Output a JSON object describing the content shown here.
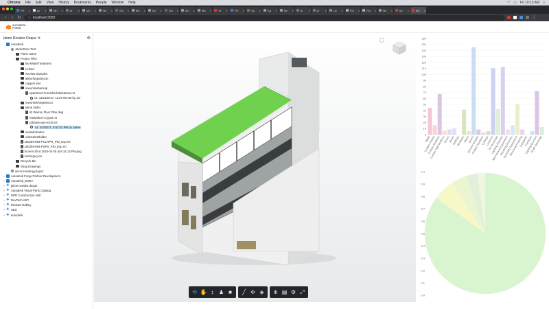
{
  "menubar": {
    "app": "Chrome",
    "items": [
      "File",
      "Edit",
      "View",
      "History",
      "Bookmarks",
      "People",
      "Window",
      "Help"
    ],
    "clock": "Fri 10:15 AM"
  },
  "browser": {
    "tabs": [
      "PR",
      "ge",
      "Mn",
      "je",
      "Mn",
      "Mn",
      "Sm",
      "Mn",
      "Mn",
      "Sm",
      "Mn",
      "Mn",
      "Yo",
      "PR",
      "Sp",
      "Aq",
      "Mn",
      "je",
      "je",
      "Lin",
      "Pro",
      "Pro",
      "Mn",
      "Mn",
      "Mn"
    ],
    "active_tab_index": 24,
    "url": "localhost:3000"
  },
  "header": {
    "logo_line1": "AUTODESK",
    "logo_line2": "FORGE",
    "logo_color": "#f0892a"
  },
  "sidebar": {
    "user": "Jaime Rosales Duque",
    "user_icon": "refresh-icon",
    "settings_icon": "gear-icon",
    "tree": [
      {
        "label": "Autodesk",
        "type": "hub",
        "level": 0,
        "toggle": "-"
      },
      {
        "label": "JaimeDocs Test",
        "type": "proj",
        "level": 1,
        "toggle": "-"
      },
      {
        "label": "Plans Jaime",
        "type": "folder",
        "level": 2,
        "toggle": ""
      },
      {
        "label": "Project Files",
        "type": "folder",
        "level": 2,
        "toggle": "-"
      },
      {
        "label": "BV-WaterTreatment",
        "type": "folder",
        "level": 3,
        "toggle": ""
      },
      {
        "label": "Linked",
        "type": "folder",
        "level": 3,
        "toggle": ""
      },
      {
        "label": "RevitIO Samples",
        "type": "folder",
        "level": 3,
        "toggle": ""
      },
      {
        "label": "aikforforgedecron",
        "type": "folder",
        "level": 3,
        "toggle": ""
      },
      {
        "label": "copperi test",
        "type": "folder",
        "level": 3,
        "toggle": ""
      },
      {
        "label": "imeonlinebackup",
        "type": "folder",
        "level": 3,
        "toggle": "-"
      },
      {
        "label": "Apartment-Furnished-Balcatons.rvt",
        "type": "file",
        "level": 4,
        "toggle": "-"
      },
      {
        "label": "v1: 11/13/2017, 11:57:06 AM by Jai",
        "type": "ver",
        "level": 5,
        "toggle": ""
      },
      {
        "label": "imeonlineforgedecon",
        "type": "folder",
        "level": 3,
        "toggle": ""
      },
      {
        "label": "jaime folder",
        "type": "folder",
        "level": 3,
        "toggle": "-"
      },
      {
        "label": "43 Warren Floor Plan.dwg",
        "type": "file",
        "level": 4,
        "toggle": ""
      },
      {
        "label": "Hackathon-Crypto.rvt",
        "type": "file",
        "level": 4,
        "toggle": ""
      },
      {
        "label": "UrbanHouse-2015.rvt",
        "type": "file",
        "level": 4,
        "toggle": "-"
      },
      {
        "label": "v1: 3/2/2017, 9:02:03 PM by Jaime",
        "type": "ver",
        "level": 5,
        "toggle": "",
        "selected": true
      },
      {
        "label": "scaledrobotics",
        "type": "folder",
        "level": 3,
        "toggle": ""
      },
      {
        "label": "visitsubnetfolder",
        "type": "folder",
        "level": 3,
        "toggle": ""
      },
      {
        "label": "180289-893-PCLRPR_PID_Exp.rvt",
        "type": "file",
        "level": 3,
        "toggle": ""
      },
      {
        "label": "180289-892-PSPS_PID_Exp.rvt",
        "type": "file",
        "level": 3,
        "toggle": ""
      },
      {
        "label": "Screen Shot 2018-02-25 at 8.14.13 PM.png",
        "type": "file",
        "level": 3,
        "toggle": ""
      },
      {
        "label": "zoeforge.json",
        "type": "file",
        "level": 3,
        "toggle": ""
      },
      {
        "label": "Recycle Bin",
        "type": "folder",
        "level": 2,
        "toggle": ""
      },
      {
        "label": "Shop Drawings",
        "type": "folder",
        "level": 2,
        "toggle": ""
      },
      {
        "label": "aecom-testing-project",
        "type": "proj",
        "level": 1,
        "toggle": ""
      },
      {
        "label": "Autodesk Forge Partner Development",
        "type": "hub",
        "level": 0,
        "toggle": "+"
      },
      {
        "label": "Autodesk_EMEA",
        "type": "hub",
        "level": 0,
        "toggle": "+"
      },
      {
        "label": "jaime.rosales.duque",
        "type": "plus",
        "level": 0,
        "toggle": "+"
      },
      {
        "label": "Autodesk Visual Parts Catalog",
        "type": "plus",
        "level": 0,
        "toggle": "+"
      },
      {
        "label": "DPR Construction Hub",
        "type": "plus",
        "level": 0,
        "toggle": "+"
      },
      {
        "label": "DevTech AEC",
        "type": "plus",
        "level": 0,
        "toggle": "+"
      },
      {
        "label": "Michael Oakley",
        "type": "plus",
        "level": 0,
        "toggle": "+"
      },
      {
        "label": "SES",
        "type": "plus",
        "level": 0,
        "toggle": "+"
      },
      {
        "label": "autodesk",
        "type": "plus",
        "level": 0,
        "toggle": "+"
      }
    ]
  },
  "viewer": {
    "toolbar": [
      [
        "orbit-icon",
        "pan-icon",
        "zoom-icon",
        "first-person-icon",
        "camera-icon"
      ],
      [
        "measure-icon",
        "explode-icon",
        "section-icon"
      ],
      [
        "model-browser-icon",
        "properties-icon",
        "settings-icon",
        "fullscreen-icon"
      ]
    ],
    "active_tool": "orbit-icon"
  },
  "chart_data": [
    {
      "type": "bar",
      "ylim": [
        0,
        160
      ],
      "yticks": [
        0,
        10,
        20,
        30,
        40,
        50,
        60,
        70,
        80,
        90,
        100,
        110,
        120,
        130,
        140,
        150,
        160
      ],
      "categories": [
        "Walls",
        "Curtain Panels",
        "Curtain Systems",
        "Curtain Wall Mullions",
        "Floors",
        "Roofs",
        "Railings",
        "Windows",
        "Stairs",
        "Doors",
        "Generic Models",
        "Curtain Systems",
        "Ceilings",
        "Columns",
        "Air Terminals",
        "Lighting Fixtures",
        "Mechanical Equipment",
        "Plumbing Fixtures",
        "Specialty Equipment",
        "Structural Framing",
        "Casework",
        "Furniture",
        "Lighting Devices",
        "Shaft Openings"
      ],
      "values": [
        44,
        15,
        67,
        6,
        8,
        10,
        0,
        41,
        5,
        145,
        8,
        3,
        5,
        110,
        42,
        112,
        8,
        15,
        50,
        8,
        0,
        5,
        72,
        12
      ],
      "colors": [
        "#f2c9d2",
        "#f9d3dc",
        "#d9c6df",
        "#fbdad4",
        "#e7d9ee",
        "#d8e3f6",
        "#dcdcdc",
        "#d7e6bf",
        "#f7e0c0",
        "#c8def2",
        "#d7cbe7",
        "#f1d6e0",
        "#cfe2c6",
        "#cdd2f3",
        "#e0f0d6",
        "#d8d0ef",
        "#f7dbe7",
        "#d6e7f6",
        "#ecefc6",
        "#e9d5ee",
        "#d9ecd0",
        "#cbe7ec",
        "#dcc6e6",
        "#d7f0da"
      ]
    },
    {
      "type": "pie",
      "ylim": [
        0,
        1
      ],
      "yticks": [
        0,
        0.1,
        0.2,
        0.3,
        0.4,
        0.5,
        0.6,
        0.7,
        0.8,
        0.9,
        1.0
      ],
      "values": [
        85,
        6,
        4,
        3,
        2
      ],
      "colors": [
        "#d9f5cf",
        "#f6f8c8",
        "#eaf6d2",
        "#e3f0d9",
        "#f0f7e0"
      ]
    }
  ]
}
